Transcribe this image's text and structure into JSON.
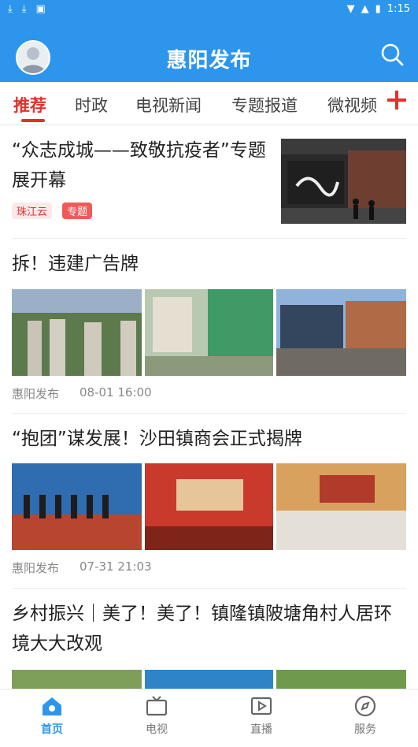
{
  "status": {
    "time": "1:15"
  },
  "app": {
    "title": "惠阳发布"
  },
  "tabs": [
    "推荐",
    "时政",
    "电视新闻",
    "专题报道",
    "微视频"
  ],
  "articles": [
    {
      "title": "“众志成城——致敬抗疫者”专题展开幕",
      "source_tag": "珠江云",
      "topic_tag": "专题"
    },
    {
      "title": "拆！违建广告牌",
      "source": "惠阳发布",
      "time": "08-01 16:00"
    },
    {
      "title": "“抱团”谋发展！沙田镇商会正式揭牌",
      "source": "惠阳发布",
      "time": "07-31 21:03"
    },
    {
      "title": "乡村振兴｜美了！美了！镇隆镇陂塘角村人居环境大大改观"
    }
  ],
  "nav": [
    "首页",
    "电视",
    "直播",
    "服务"
  ],
  "colors": {
    "accent": "#2d96ec",
    "active_tab": "#e0312b"
  }
}
